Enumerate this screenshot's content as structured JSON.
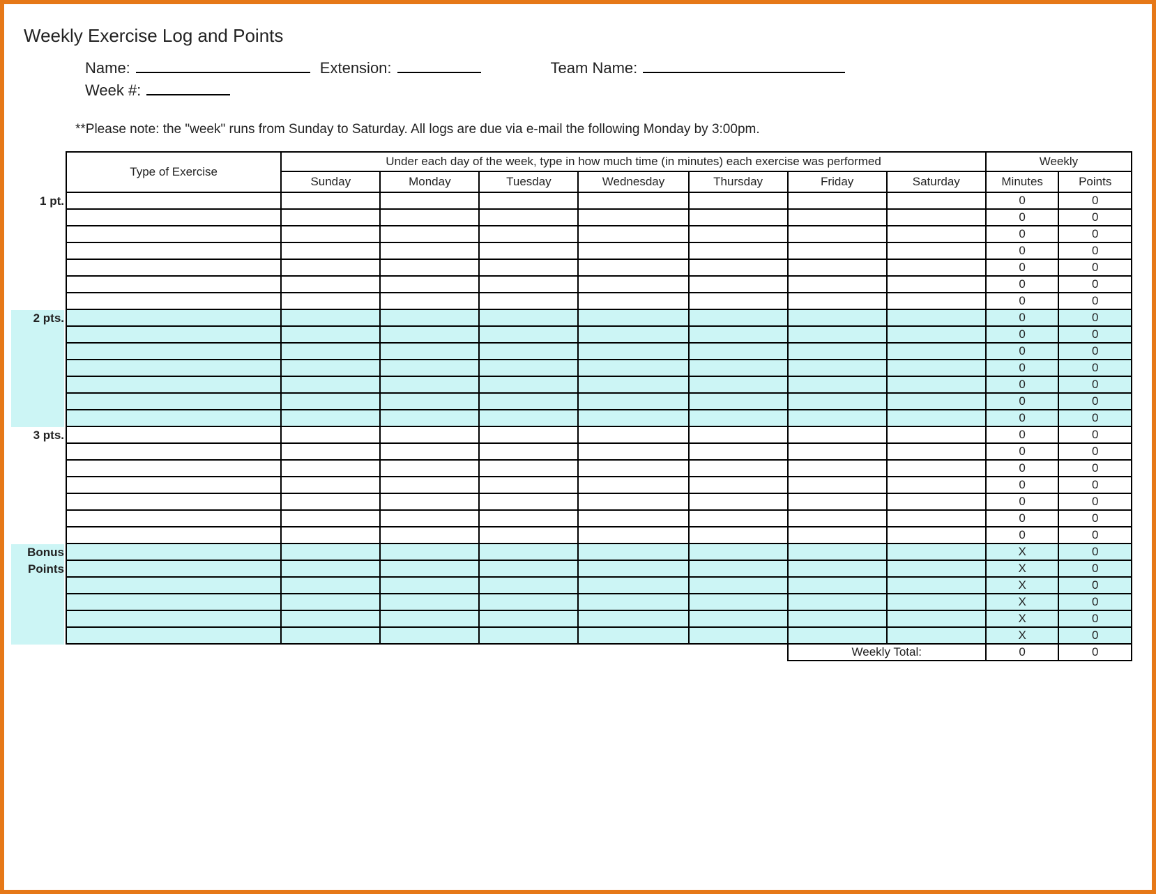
{
  "title": "Weekly Exercise Log and Points",
  "fields": {
    "name_label": "Name:",
    "extension_label": "Extension:",
    "team_label": "Team Name:",
    "week_label": "Week #:"
  },
  "note": "**Please note: the \"week\" runs from Sunday to Saturday.  All logs are due via e-mail the following Monday by 3:00pm.",
  "headers": {
    "type": "Type of Exercise",
    "instr": "Under each day of the week, type in how much time (in minutes) each exercise was performed",
    "weekly": "Weekly",
    "days": [
      "Sunday",
      "Monday",
      "Tuesday",
      "Wednesday",
      "Thursday",
      "Friday",
      "Saturday"
    ],
    "minutes": "Minutes",
    "points": "Points"
  },
  "sections": [
    {
      "label": "1 pt.",
      "rows": 7,
      "tint": false,
      "minutes": "0",
      "points": "0"
    },
    {
      "label": "2 pts.",
      "rows": 7,
      "tint": true,
      "minutes": "0",
      "points": "0"
    },
    {
      "label": "3 pts.",
      "rows": 7,
      "tint": false,
      "minutes": "0",
      "points": "0"
    },
    {
      "label": "Bonus\nPoints",
      "rows": 6,
      "tint": true,
      "minutes": "X",
      "points": "0"
    }
  ],
  "total": {
    "label": "Weekly Total:",
    "minutes": "0",
    "points": "0"
  }
}
